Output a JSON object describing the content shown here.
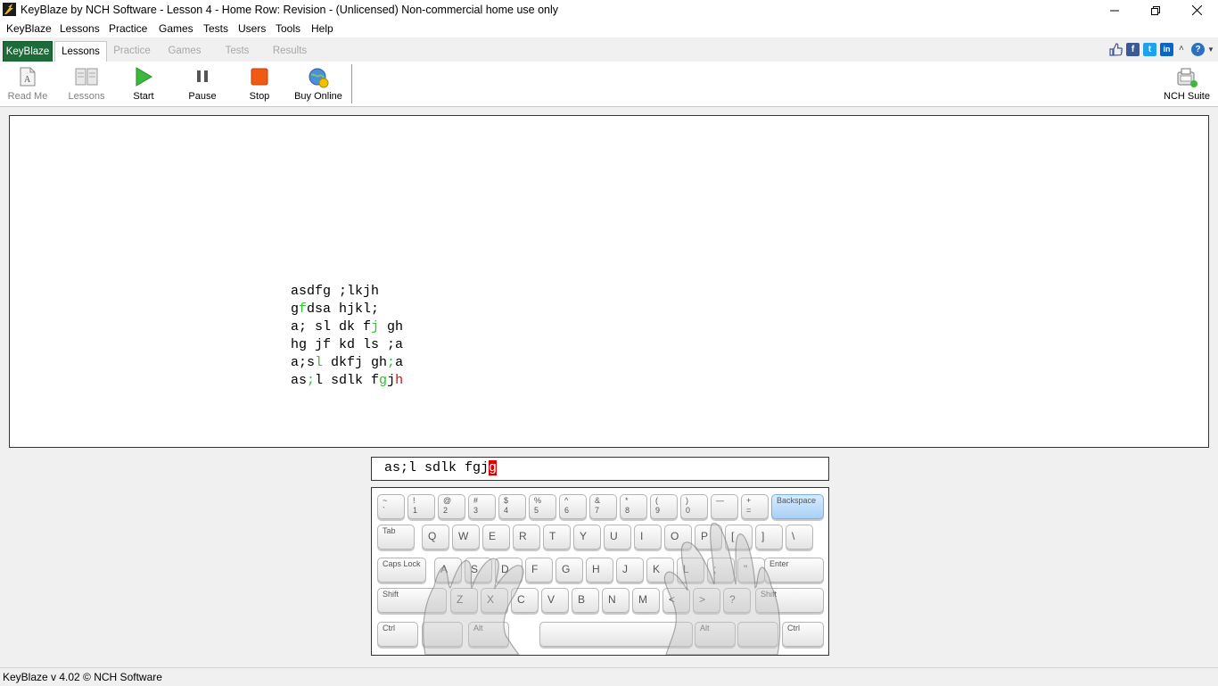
{
  "window": {
    "title": "KeyBlaze by NCH Software - Lesson 4 - Home Row: Revision - (Unlicensed) Non-commercial home use only"
  },
  "menu": [
    "KeyBlaze",
    "Lessons",
    "Practice",
    "Games",
    "Tests",
    "Users",
    "Tools",
    "Help"
  ],
  "tabs": {
    "keyblaze": "KeyBlaze",
    "lessons": "Lessons",
    "practice": "Practice",
    "games": "Games",
    "tests": "Tests",
    "results": "Results",
    "active": "Lessons"
  },
  "social": {
    "facebook": "f",
    "twitter": "t",
    "linkedin": "in",
    "help": "?"
  },
  "toolbar": {
    "read_me": "Read Me",
    "lessons": "Lessons",
    "start": "Start",
    "pause": "Pause",
    "stop": "Stop",
    "buy_online": "Buy Online",
    "nch_suite": "NCH Suite"
  },
  "lesson": {
    "lines": [
      [
        {
          "t": "asdfg ;lkjh",
          "c": ""
        }
      ],
      [
        {
          "t": "g",
          "c": ""
        },
        {
          "t": "f",
          "c": "ok"
        },
        {
          "t": "dsa hjkl;",
          "c": ""
        }
      ],
      [
        {
          "t": "a; sl dk f",
          "c": ""
        },
        {
          "t": "j",
          "c": "ok"
        },
        {
          "t": " gh",
          "c": ""
        }
      ],
      [
        {
          "t": "hg jf kd ls ;a",
          "c": ""
        }
      ],
      [
        {
          "t": "a;s",
          "c": ""
        },
        {
          "t": "l",
          "c": "ok"
        },
        {
          "t": " dkfj gh",
          "c": ""
        },
        {
          "t": ";",
          "c": "ok"
        },
        {
          "t": "a",
          "c": ""
        }
      ],
      [
        {
          "t": "as",
          "c": ""
        },
        {
          "t": ";",
          "c": "ok"
        },
        {
          "t": "l sdlk f",
          "c": ""
        },
        {
          "t": "g",
          "c": "ok"
        },
        {
          "t": "j",
          "c": ""
        },
        {
          "t": "h",
          "c": "err"
        }
      ]
    ]
  },
  "typing": {
    "typed": "as;l sdlk fgj",
    "current_char": "g"
  },
  "keyboard": {
    "highlighted": "Backspace",
    "row1": [
      [
        "~",
        "`"
      ],
      [
        "!",
        "1"
      ],
      [
        "@",
        "2"
      ],
      [
        "#",
        "3"
      ],
      [
        "$",
        "4"
      ],
      [
        "%",
        "5"
      ],
      [
        "^",
        "6"
      ],
      [
        "&",
        "7"
      ],
      [
        "*",
        "8"
      ],
      [
        "(",
        "9"
      ],
      [
        ")",
        "0"
      ],
      [
        "—",
        ""
      ],
      [
        "+",
        "="
      ]
    ],
    "backspace": "Backspace",
    "tab": "Tab",
    "row2": [
      "Q",
      "W",
      "E",
      "R",
      "T",
      "Y",
      "U",
      "I",
      "O",
      "P",
      "[",
      "]",
      "\\"
    ],
    "caps": "Caps Lock",
    "row3": [
      "A",
      "S",
      "D",
      "F",
      "G",
      "H",
      "J",
      "K",
      "L",
      ";",
      "\""
    ],
    "enter": "Enter",
    "shift_left": "Shift",
    "row4": [
      "Z",
      "X",
      "C",
      "V",
      "B",
      "N",
      "M",
      "<",
      ">",
      "?"
    ],
    "shift_right": "Shift",
    "ctrl": "Ctrl",
    "alt": "Alt"
  },
  "status": {
    "text": "KeyBlaze v 4.02 © NCH Software"
  }
}
